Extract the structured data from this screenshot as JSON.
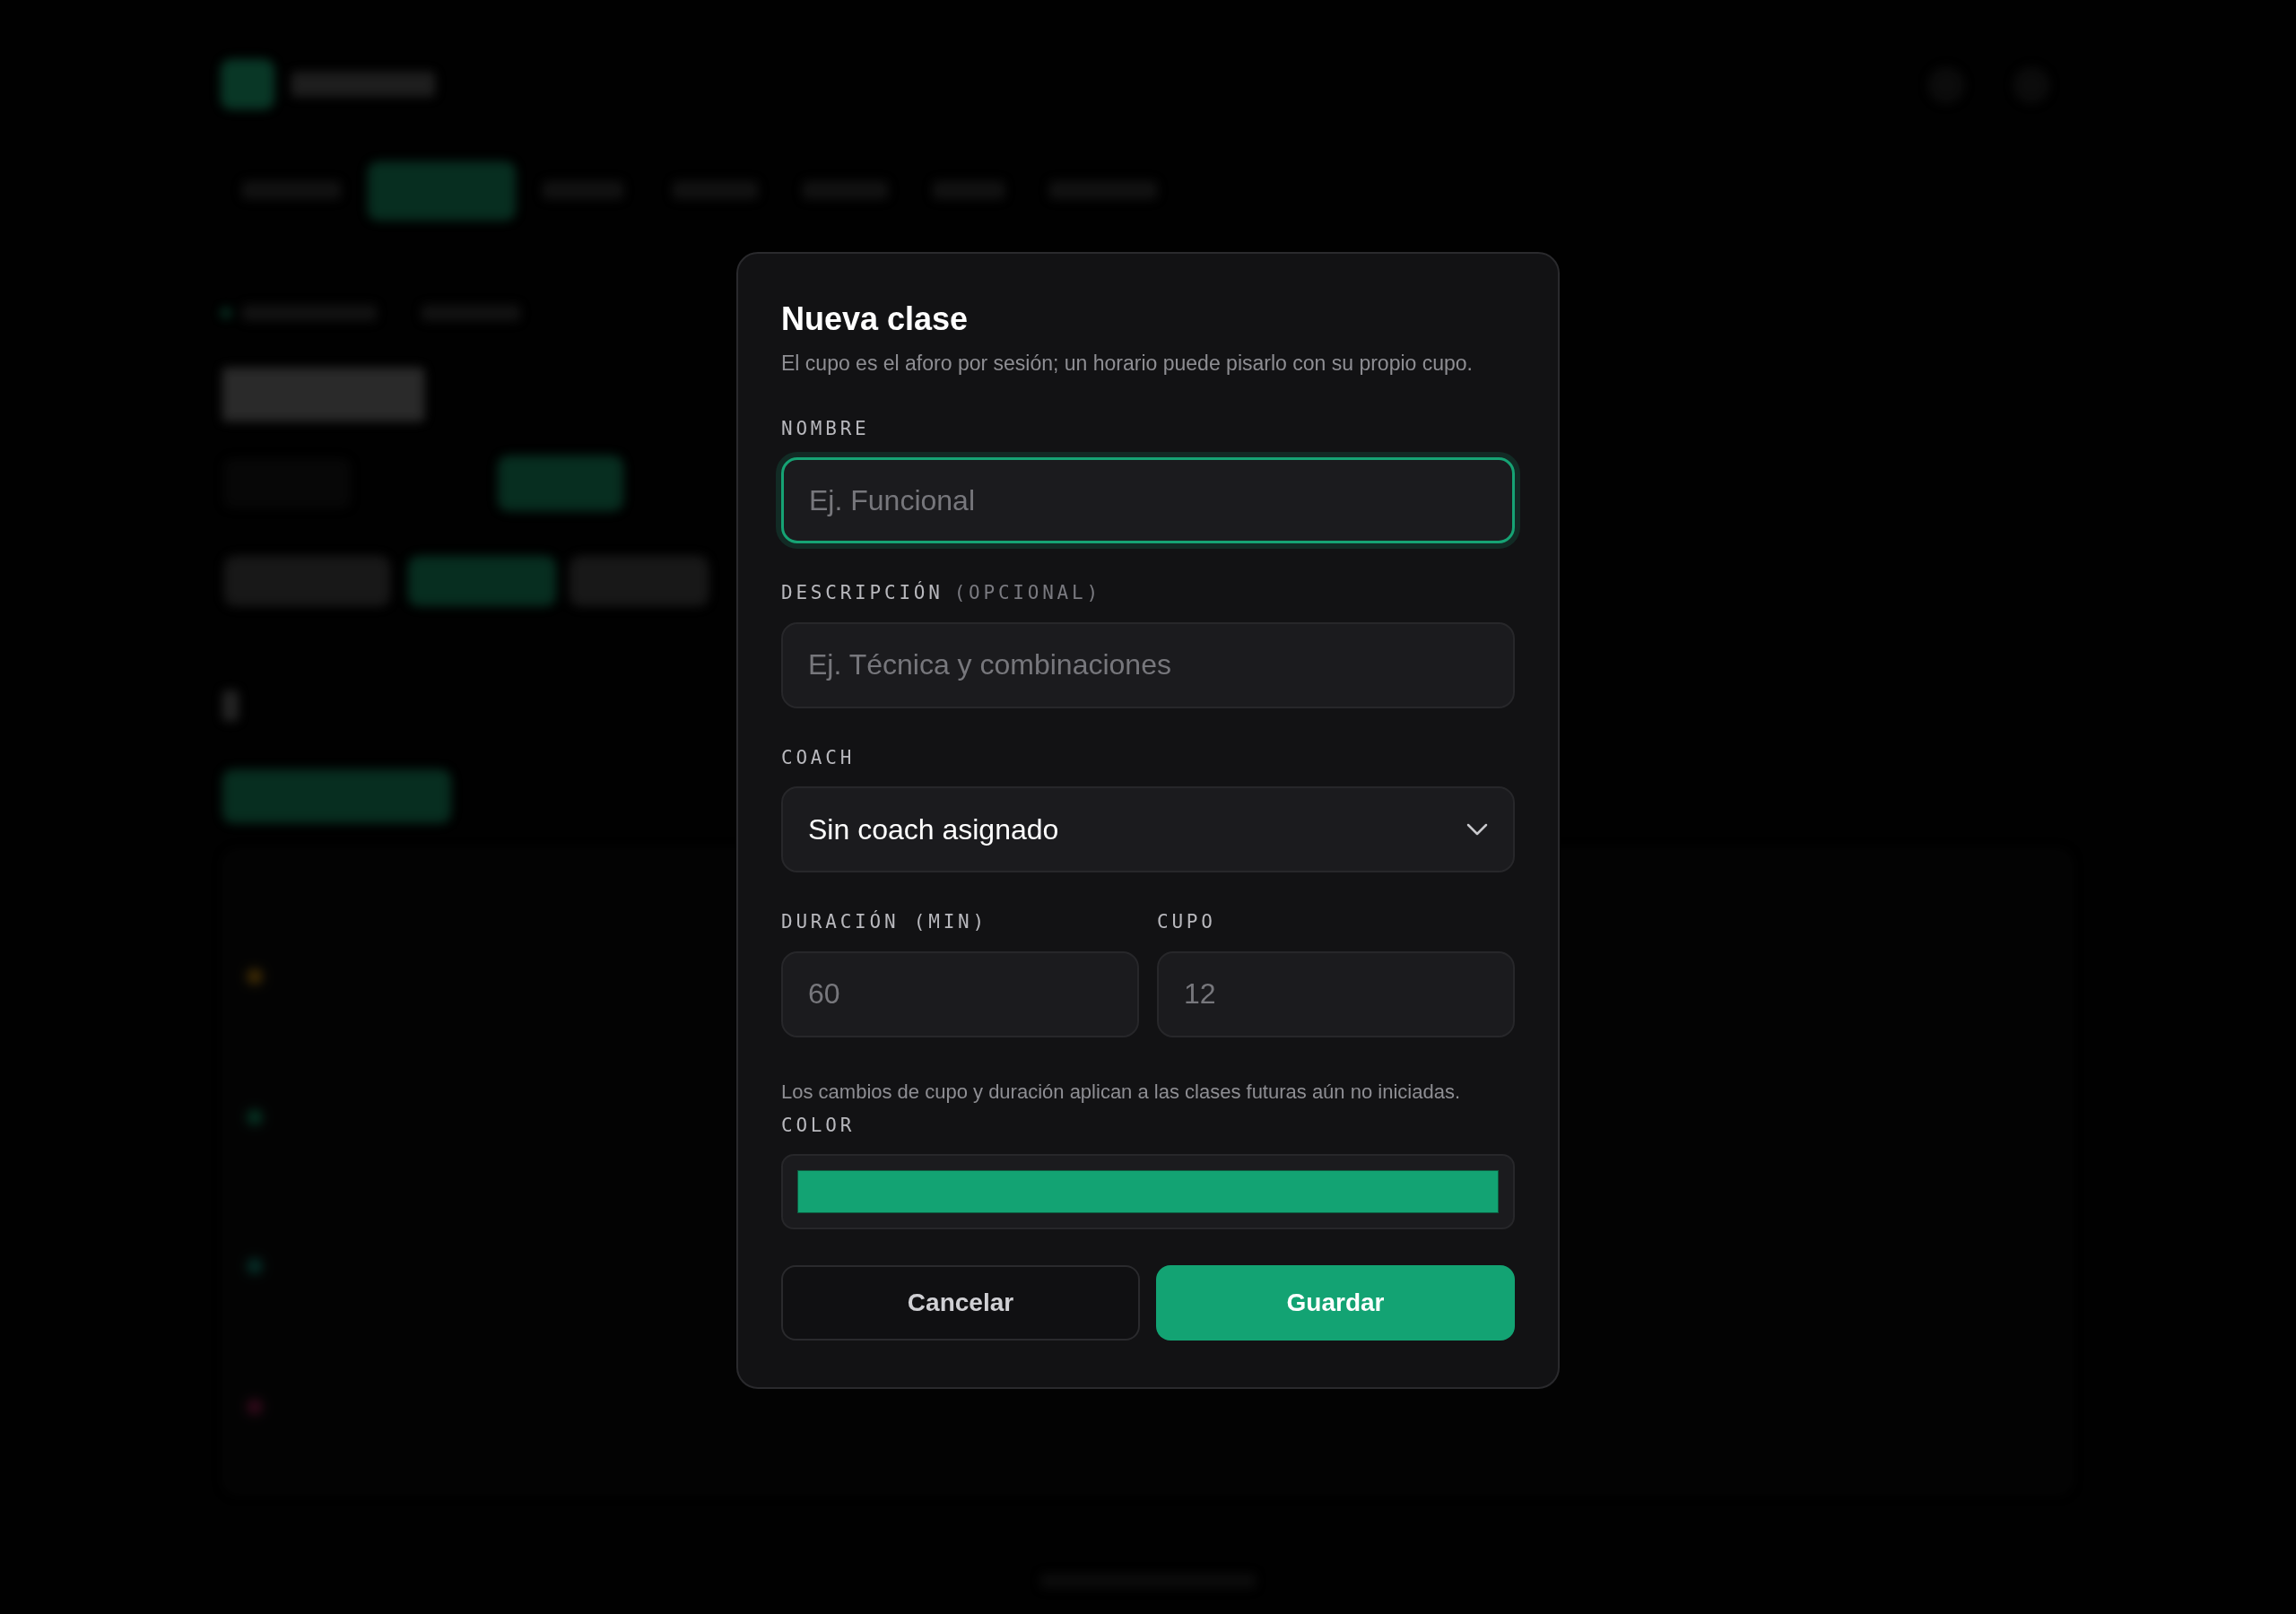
{
  "dialog": {
    "title": "Nueva clase",
    "subtitle": "El cupo es el aforo por sesión; un horario puede pisarlo con su propio cupo.",
    "fields": [
      {
        "kind": "text",
        "label": "NOMBRE",
        "placeholder": "Ej. Funcional",
        "focused": true
      },
      {
        "kind": "text",
        "label": "DESCRIPCIÓN",
        "label_hint": "(OPCIONAL)",
        "placeholder": "Ej. Técnica y combinaciones",
        "focused": false
      },
      {
        "kind": "select",
        "label": "COACH",
        "value": "Sin coach asignado",
        "focused": false
      },
      {
        "kind": "pair",
        "items": [
          {
            "label": "DURACIÓN (MIN)",
            "placeholder": "60",
            "focused": false
          },
          {
            "label": "CUPO",
            "placeholder": "12",
            "focused": false
          }
        ]
      }
    ],
    "note": "Los cambios de cupo y duración aplican a las clases futuras aún no iniciadas.",
    "color_field": {
      "label": "COLOR",
      "color": "#13a373"
    },
    "buttons": [
      {
        "kind": "secondary",
        "label": "Cancelar"
      },
      {
        "kind": "primary",
        "label": "Guardar"
      }
    ]
  }
}
